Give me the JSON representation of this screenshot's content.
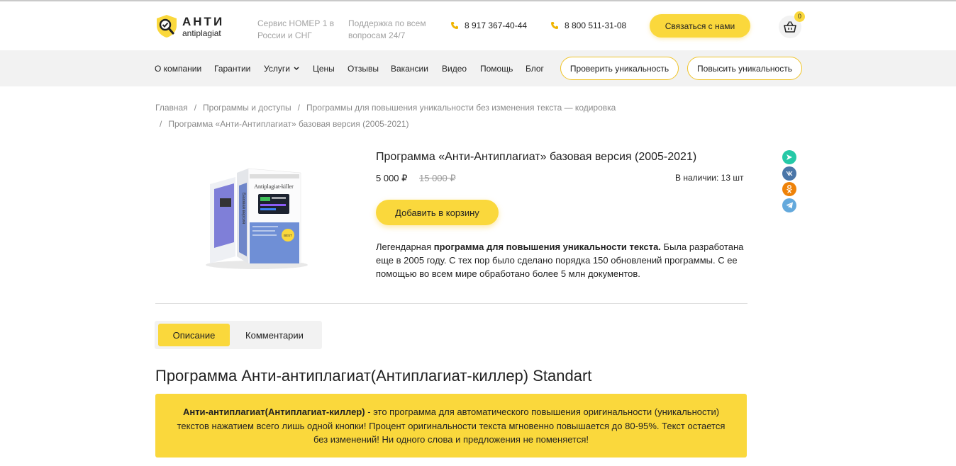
{
  "header": {
    "logo": {
      "top": "АНТИ",
      "bottom": "antiplagiat"
    },
    "taglines": [
      "Сервис НОМЕР 1 в России и СНГ",
      "Поддержка по всем вопросам 24/7"
    ],
    "phones": [
      "8 917 367-40-44",
      "8 800 511-31-08"
    ],
    "contact_label": "Связаться с нами",
    "cart_count": "0"
  },
  "nav": {
    "items": [
      "О компании",
      "Гарантии",
      "Услуги",
      "Цены",
      "Отзывы",
      "Вакансии",
      "Видео",
      "Помощь",
      "Блог"
    ],
    "check_label": "Проверить уникальность",
    "raise_label": "Повысить уникальность"
  },
  "breadcrumb": {
    "items": [
      "Главная",
      "Программы и доступы",
      "Программы для повышения уникальности без изменения текста — кодировка",
      "Программа «Анти-Антиплагиат» базовая версия (2005-2021)"
    ]
  },
  "product": {
    "title": "Программа «Анти-Антиплагиат» базовая версия (2005-2021)",
    "price": "5 000 ₽",
    "old_price": "15 000 ₽",
    "stock": "В наличии: 13 шт",
    "add_to_cart": "Добавить в корзину",
    "desc_pre": "Легендарная ",
    "desc_bold": "программа для повышения уникальности текста.",
    "desc_post": " Была разработана еще в 2005 году. С тех пор было сделано порядка 150 обновлений программы. С ее помощью во всем мире обработано более 5 млн документов.",
    "box_front_title": "Antiplagiat-killer",
    "box_side_title": "Базовая версия",
    "box_badge": "BEST"
  },
  "share": [
    "icq-new-icon",
    "vk-icon",
    "odnoklassniki-icon",
    "telegram-icon"
  ],
  "tabs": [
    "Описание",
    "Комментарии"
  ],
  "section": {
    "title": "Программа Анти-антиплагиат(Антиплагиат-киллер) Standart",
    "box_bold": "Анти-антиплагиат(Антиплагиат-киллер)",
    "box_text": " - это программа для автоматического повышения оригинальности (уникальности) текстов нажатием всего лишь одной кнопки! Процент оригинальности текста мгновенно повышается до 80-95%. Текст остается без изменений! Ни одного слова и предложения не поменяется!"
  },
  "colors": {
    "accent": "#fad83c",
    "nav_bg": "#f2f2f2"
  }
}
